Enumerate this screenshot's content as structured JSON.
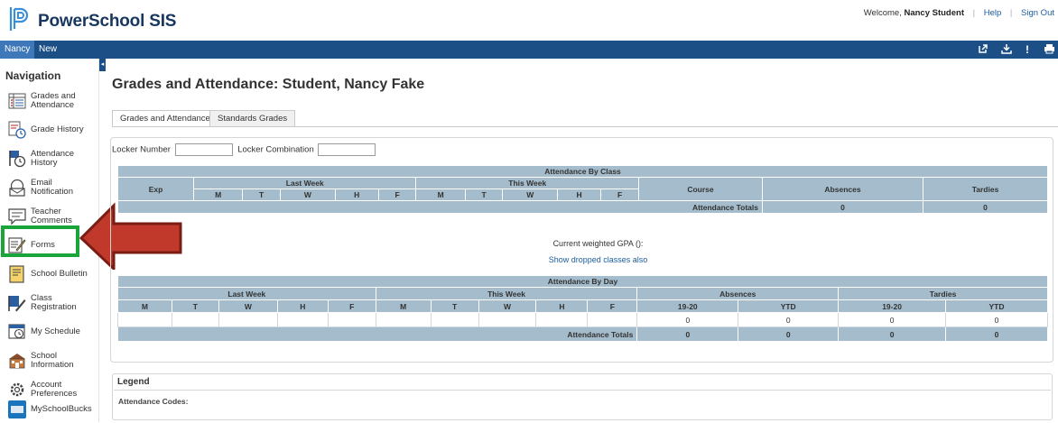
{
  "header": {
    "logo_text": "PowerSchool SIS",
    "welcome_prefix": "Welcome,",
    "user_name": "Nancy Student",
    "help_label": "Help",
    "signout_label": "Sign Out"
  },
  "topbar": {
    "tabs": [
      {
        "label": "Nancy"
      },
      {
        "label": "New"
      }
    ],
    "icons": [
      "external-link-icon",
      "download-icon",
      "alert-icon",
      "print-icon"
    ]
  },
  "sidebar": {
    "title": "Navigation",
    "items": [
      {
        "label": "Grades and Attendance",
        "icon": "grades-icon"
      },
      {
        "label": "Grade History",
        "icon": "grade-history-icon"
      },
      {
        "label": "Attendance History",
        "icon": "attendance-history-icon"
      },
      {
        "label": "Email Notification",
        "icon": "email-icon"
      },
      {
        "label": "Teacher Comments",
        "icon": "comments-icon"
      },
      {
        "label": "Forms",
        "icon": "forms-icon"
      },
      {
        "label": "School Bulletin",
        "icon": "bulletin-icon"
      },
      {
        "label": "Class Registration",
        "icon": "registration-icon"
      },
      {
        "label": "My Schedule",
        "icon": "schedule-icon"
      },
      {
        "label": "School Information",
        "icon": "school-icon"
      },
      {
        "label": "Account Preferences",
        "icon": "preferences-icon"
      },
      {
        "label": "MySchoolBucks",
        "icon": "myschoolbucks-icon"
      }
    ]
  },
  "main": {
    "title": "Grades and Attendance: Student, Nancy Fake",
    "tabs": [
      {
        "label": "Grades and Attendance"
      },
      {
        "label": "Standards Grades"
      }
    ],
    "locker_number_label": "Locker Number",
    "locker_combination_label": "Locker Combination",
    "attendance_by_class": {
      "title": "Attendance By Class",
      "exp_label": "Exp",
      "last_week_label": "Last Week",
      "this_week_label": "This Week",
      "days": [
        "M",
        "T",
        "W",
        "H",
        "F"
      ],
      "course_label": "Course",
      "absences_label": "Absences",
      "tardies_label": "Tardies",
      "totals_label": "Attendance Totals",
      "absences_total": "0",
      "tardies_total": "0"
    },
    "gpa_text": "Current weighted GPA ():",
    "dropped_link": "Show dropped classes also",
    "attendance_by_day": {
      "title": "Attendance By Day",
      "last_week_label": "Last Week",
      "this_week_label": "This Week",
      "absences_label": "Absences",
      "tardies_label": "Tardies",
      "days": [
        "M",
        "T",
        "W",
        "H",
        "F"
      ],
      "period_labels": [
        "19-20",
        "YTD"
      ],
      "row_values": [
        "0",
        "0",
        "0",
        "0"
      ],
      "totals_label": "Attendance Totals",
      "totals_values": [
        "0",
        "0",
        "0",
        "0"
      ]
    },
    "legend": {
      "title": "Legend",
      "codes_label": "Attendance Codes:"
    }
  },
  "colors": {
    "brand_blue": "#1b4f86",
    "table_header": "#a4bccb",
    "highlight_green": "#19a53a",
    "arrow_red": "#c0392b"
  }
}
